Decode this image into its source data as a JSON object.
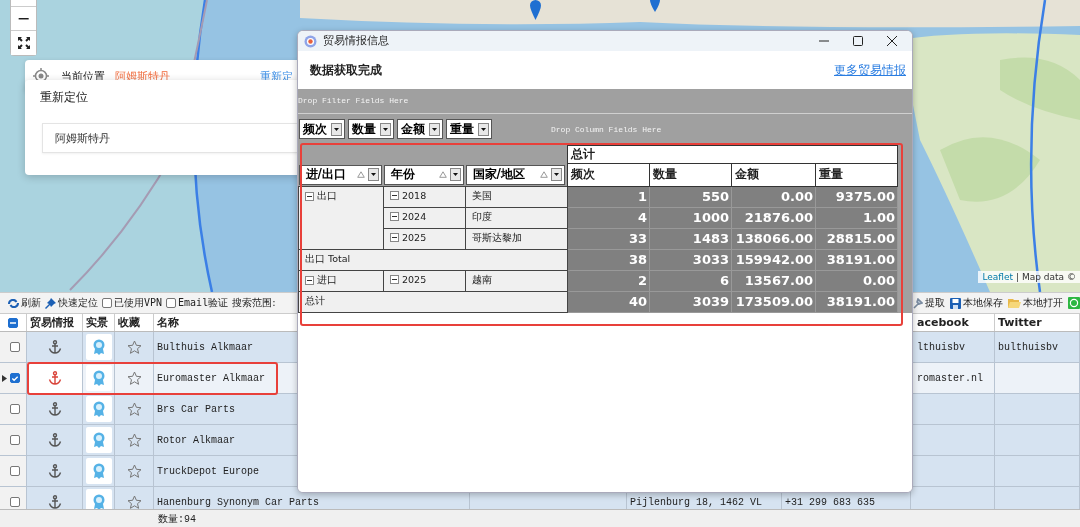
{
  "map": {
    "zoom_out": "−",
    "attribution_link": "Leaflet",
    "attribution": "| Map data ©"
  },
  "location_card": {
    "label": "当前位置",
    "city": "阿姆斯特丹",
    "relocate_link": "重新定"
  },
  "relocate_popup": {
    "title": "重新定位",
    "input_value": "阿姆斯特丹"
  },
  "toolbar": {
    "left": [
      {
        "kind": "refresh",
        "label": "刷新"
      },
      {
        "kind": "locate",
        "label": "快速定位"
      },
      {
        "kind": "checkbox",
        "label": "已使用VPN",
        "checked": false
      },
      {
        "kind": "checkbox",
        "label": "Email验证",
        "checked": false
      },
      {
        "kind": "text",
        "label": "搜索范围:"
      }
    ],
    "right": [
      {
        "kind": "extract",
        "label": "提取"
      },
      {
        "kind": "save",
        "label": "本地保存"
      },
      {
        "kind": "open",
        "label": "本地打开"
      },
      {
        "kind": "whatsapp"
      }
    ]
  },
  "table": {
    "select_all_partial": true,
    "columns": [
      "贸易情报",
      "实景",
      "收藏",
      "名称",
      "acebook",
      "Twitter"
    ],
    "rows": [
      {
        "checked": false,
        "selected": false,
        "name": "Bulthuis Alkmaar",
        "facebook": "lthuisbv",
        "twitter": "bulthuisbv"
      },
      {
        "checked": true,
        "selected": true,
        "name": "Euromaster Alkmaar",
        "facebook": "romaster.nl"
      },
      {
        "checked": false,
        "selected": false,
        "name": "Brs Car Parts"
      },
      {
        "checked": false,
        "selected": false,
        "name": "Rotor Alkmaar"
      },
      {
        "checked": false,
        "selected": false,
        "name": "TruckDepot Europe"
      },
      {
        "checked": false,
        "selected": false,
        "name": "Hanenburg Synonym Car Parts",
        "address": "Pijlenburg 18, 1462 VL",
        "phone": "+31 299 683 635"
      }
    ]
  },
  "status_bar": {
    "count": "数量:94"
  },
  "window": {
    "title": "贸易情报信息",
    "status": "数据获取完成",
    "more_link": "更多贸易情报",
    "filter_hint": "Drop Filter Fields Here",
    "column_hint": "Drop Column Fields Here",
    "data_fields": [
      "频次",
      "数量",
      "金额",
      "重量"
    ],
    "row_fields": [
      "进/出口",
      "年份",
      "国家/地区"
    ],
    "grand_header": "总计",
    "value_headers": [
      "频次",
      "数量",
      "金额",
      "重量"
    ],
    "rows": [
      {
        "kind": "group",
        "label": "出口",
        "expanded": true,
        "children": [
          {
            "label": "2018",
            "expanded": true,
            "children": [
              {
                "label": "美国",
                "values": [
                  "1",
                  "550",
                  "0.00",
                  "9375.00"
                ]
              }
            ]
          },
          {
            "label": "2024",
            "expanded": true,
            "children": [
              {
                "label": "印度",
                "values": [
                  "4",
                  "1000",
                  "21876.00",
                  "1.00"
                ]
              }
            ]
          },
          {
            "label": "2025",
            "expanded": true,
            "children": [
              {
                "label": "哥斯达黎加",
                "values": [
                  "33",
                  "1483",
                  "138066.00",
                  "28815.00"
                ]
              }
            ]
          }
        ]
      },
      {
        "kind": "total",
        "label": "出口 Total",
        "values": [
          "38",
          "3033",
          "159942.00",
          "38191.00"
        ]
      },
      {
        "kind": "group",
        "label": "进口",
        "expanded": true,
        "children": [
          {
            "label": "2025",
            "expanded": true,
            "children": [
              {
                "label": "越南",
                "values": [
                  "2",
                  "6",
                  "13567.00",
                  "0.00"
                ]
              }
            ]
          }
        ]
      },
      {
        "kind": "total",
        "label": "总计",
        "values": [
          "40",
          "3039",
          "173509.00",
          "38191.00"
        ]
      }
    ]
  }
}
